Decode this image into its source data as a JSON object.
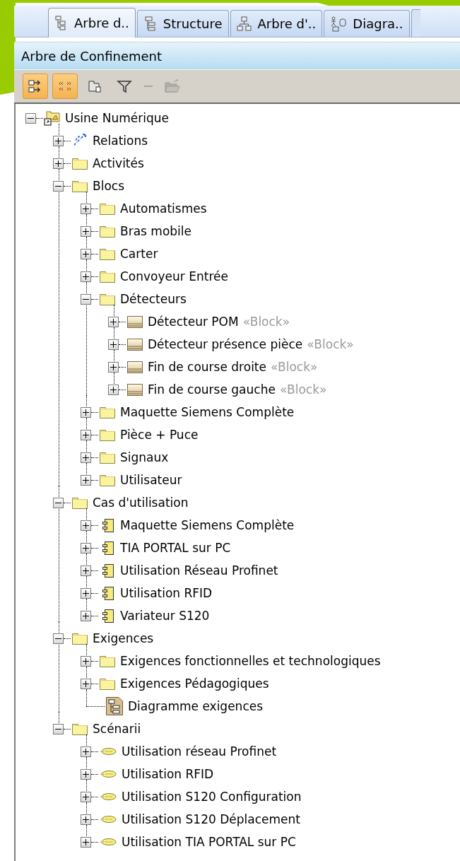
{
  "tabs": [
    {
      "label": "Arbre d..",
      "kind": "tree",
      "selected": true
    },
    {
      "label": "Structure",
      "kind": "structure",
      "selected": false
    },
    {
      "label": "Arbre d'..",
      "kind": "hierarchy",
      "selected": false
    },
    {
      "label": "Diagra..",
      "kind": "diagram",
      "selected": false
    }
  ],
  "panel": {
    "title": "Arbre de Confinement"
  },
  "toolbar": [
    {
      "kind": "sort",
      "pressed": true,
      "disabled": false
    },
    {
      "kind": "stereotype",
      "pressed": true,
      "disabled": false
    },
    {
      "kind": "package",
      "pressed": false,
      "disabled": false
    },
    {
      "kind": "filter",
      "pressed": false,
      "disabled": false
    },
    {
      "kind": "collapse",
      "pressed": false,
      "disabled": true
    },
    {
      "kind": "open",
      "pressed": false,
      "disabled": true
    }
  ],
  "tree": [
    {
      "label": "Usine Numérique",
      "kind": "model",
      "expanded": true,
      "children": [
        {
          "label": "Relations",
          "kind": "relations",
          "expanded": false
        },
        {
          "label": "Activités",
          "kind": "package",
          "expanded": false
        },
        {
          "label": "Blocs",
          "kind": "package",
          "expanded": true,
          "children": [
            {
              "label": "Automatismes",
              "kind": "package",
              "expanded": false
            },
            {
              "label": "Bras mobile",
              "kind": "package",
              "expanded": false
            },
            {
              "label": "Carter",
              "kind": "package",
              "expanded": false
            },
            {
              "label": "Convoyeur Entrée",
              "kind": "package",
              "expanded": false
            },
            {
              "label": "Détecteurs",
              "kind": "package",
              "expanded": true,
              "children": [
                {
                  "label": "Détecteur POM",
                  "stereotype": "«Block»",
                  "kind": "block",
                  "expanded": false
                },
                {
                  "label": "Détecteur présence pièce",
                  "stereotype": "«Block»",
                  "kind": "block",
                  "expanded": false
                },
                {
                  "label": "Fin de course droite",
                  "stereotype": "«Block»",
                  "kind": "block",
                  "expanded": false
                },
                {
                  "label": "Fin de course gauche",
                  "stereotype": "«Block»",
                  "kind": "block",
                  "expanded": false
                }
              ]
            },
            {
              "label": "Maquette Siemens Complète",
              "kind": "package",
              "expanded": false
            },
            {
              "label": "Pièce + Puce",
              "kind": "package",
              "expanded": false
            },
            {
              "label": "Signaux",
              "kind": "package",
              "expanded": false
            },
            {
              "label": "Utilisateur",
              "kind": "package",
              "expanded": false
            }
          ]
        },
        {
          "label": "Cas d'utilisation",
          "kind": "package",
          "expanded": true,
          "children": [
            {
              "label": "Maquette Siemens Complète",
              "kind": "component",
              "expanded": false
            },
            {
              "label": "TIA PORTAL sur PC",
              "kind": "component",
              "expanded": false
            },
            {
              "label": "Utilisation Réseau Profinet",
              "kind": "component",
              "expanded": false
            },
            {
              "label": "Utilisation RFID",
              "kind": "component",
              "expanded": false
            },
            {
              "label": "Variateur S120",
              "kind": "component",
              "expanded": false
            }
          ]
        },
        {
          "label": "Exigences",
          "kind": "package",
          "expanded": true,
          "children": [
            {
              "label": "Exigences fonctionnelles et technologiques",
              "kind": "package",
              "expanded": false
            },
            {
              "label": "Exigences Pédagogiques",
              "kind": "package",
              "expanded": false
            },
            {
              "label": "Diagramme exigences",
              "kind": "diagram"
            }
          ]
        },
        {
          "label": "Scénarii",
          "kind": "package",
          "expanded": true,
          "children": [
            {
              "label": "Utilisation réseau Profinet",
              "kind": "interaction",
              "expanded": false
            },
            {
              "label": "Utilisation RFID",
              "kind": "interaction",
              "expanded": false
            },
            {
              "label": "Utilisation S120 Configuration",
              "kind": "interaction",
              "expanded": false
            },
            {
              "label": "Utilisation S120 Déplacement",
              "kind": "interaction",
              "expanded": false
            },
            {
              "label": "Utilisation TIA PORTAL sur PC",
              "kind": "interaction",
              "expanded": false
            }
          ]
        }
      ]
    }
  ]
}
